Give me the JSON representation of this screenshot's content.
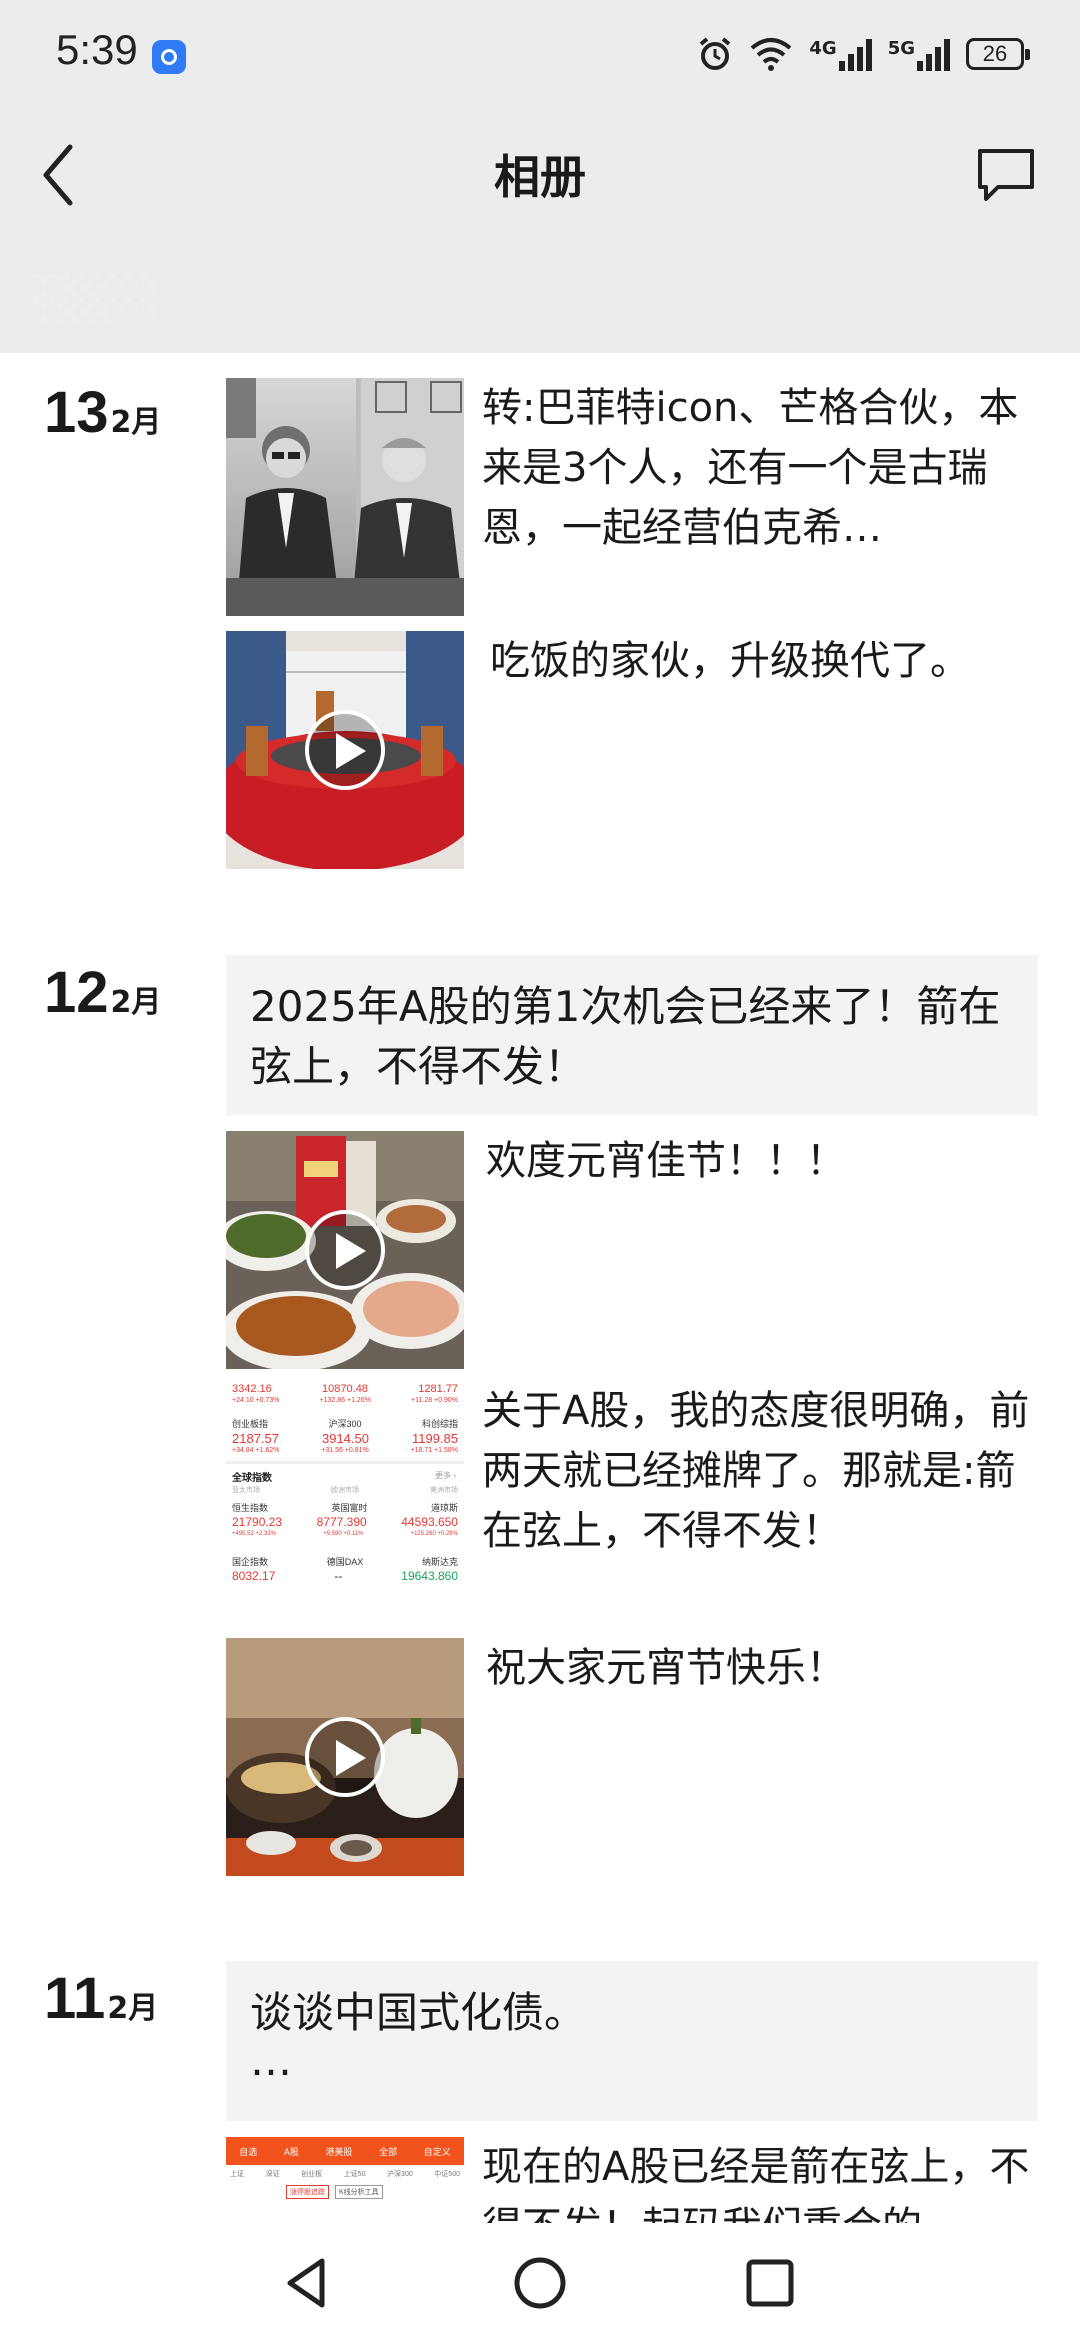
{
  "status": {
    "time": "5:39",
    "net1": "4G",
    "net2": "5G",
    "battery": "26"
  },
  "nav": {
    "title": "相册"
  },
  "feed": [
    {
      "day": "13",
      "month": "2月",
      "posts": [
        {
          "text": "转:巴菲特icon、芒格合伙，本来是3个人，还有一个是古瑞恩，一起经营伯克希…",
          "thumb": "photo-two-men",
          "video": false
        },
        {
          "text": "吃饭的家伙，升级换代了。",
          "thumb": "round-dining-table",
          "video": true
        }
      ]
    },
    {
      "day": "12",
      "month": "2月",
      "card": "2025年A股的第1次机会已经来了！箭在弦上，不得不发！",
      "posts": [
        {
          "text": "欢度元宵佳节！！！",
          "thumb": "festival-dinner",
          "video": true
        },
        {
          "text": "关于A股，我的态度很明确，前两天就已经摊牌了。那就是:箭在弦上，不得不发！",
          "thumb": "stock-index-screenshot",
          "video": false
        },
        {
          "text": "祝大家元宵节快乐！",
          "thumb": "tea-table",
          "video": true
        }
      ]
    },
    {
      "day": "11",
      "month": "2月",
      "card": "谈谈中国式化债。",
      "card_more": "…",
      "posts": [
        {
          "text": "现在的A股已经是箭在弦上，不得不发！起码我们重合的",
          "thumb": "stock-app-screenshot",
          "video": false
        }
      ]
    }
  ],
  "stock_thumb": {
    "top_row": [
      "3342.16",
      "10870.48",
      "1281.77"
    ],
    "top_changes": [
      "+24.10 +0.73%",
      "+132.86 +1.26%",
      "+11.28 +0.90%"
    ],
    "row1_names": [
      "创业板指",
      "沪深300",
      "科创综指"
    ],
    "row1_vals": [
      "2187.57",
      "3914.50",
      "1199.85"
    ],
    "row1_changes": [
      "+34.84 +1.62%",
      "+31.56 +0.81%",
      "+18.71 +1.58%"
    ],
    "section": "全球指数",
    "more": "更多 ›",
    "tabs": [
      "亚太市场",
      "欧洲市场",
      "美洲市场"
    ],
    "row2_names": [
      "恒生指数",
      "英国富时",
      "道琼斯"
    ],
    "row2_vals": [
      "21790.23",
      "8777.390",
      "44593.650"
    ],
    "row2_changes": [
      "+495.52 +2.33%",
      "+9.590 +0.11%",
      "+125.260 +0.28%"
    ],
    "row3_names": [
      "国企指数",
      "德国DAX",
      "纳斯达克"
    ],
    "row3_vals": [
      "8032.17",
      "--",
      "19643.860"
    ]
  },
  "app_thumb": {
    "tabs": [
      "自选",
      "A股",
      "港美股",
      "全部",
      "自定义"
    ],
    "subtabs": [
      "上证",
      "深证",
      "创业板",
      "上证50",
      "沪深300",
      "中证500"
    ],
    "buttons": [
      "涨停股追踪",
      "K线分析工具"
    ]
  },
  "colors": {
    "header_bg": "#ececec",
    "card_bg": "#f3f3f3",
    "stock_red": "#e53935",
    "stock_green": "#1aa35a",
    "app_orange": "#f2521c"
  }
}
